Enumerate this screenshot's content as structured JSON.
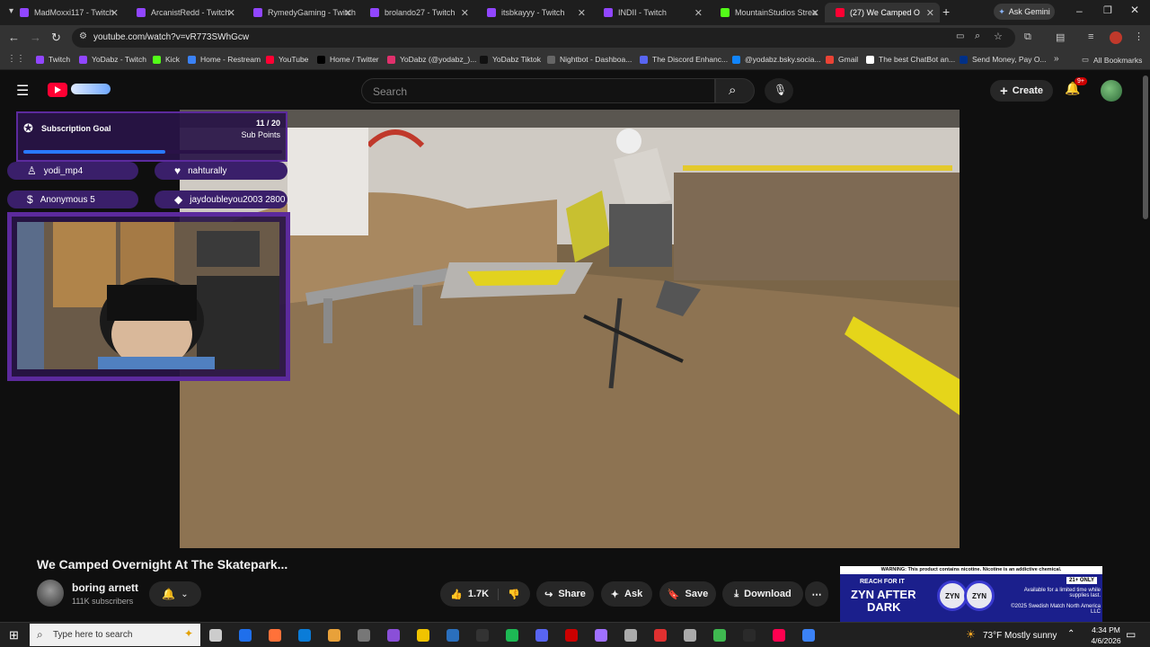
{
  "tabs": [
    {
      "label": "MadMoxxi117 - Twitch",
      "color": "#9146ff"
    },
    {
      "label": "ArcanistRedd - Twitch",
      "color": "#9146ff"
    },
    {
      "label": "RymedyGaming - Twitch",
      "color": "#9146ff"
    },
    {
      "label": "brolando27 - Twitch",
      "color": "#9146ff"
    },
    {
      "label": "itsbkayyy - Twitch",
      "color": "#9146ff"
    },
    {
      "label": "INDII - Twitch",
      "color": "#9146ff"
    },
    {
      "label": "MountainStudios Strea",
      "color": "#53fc18"
    },
    {
      "label": "(27) We Camped O",
      "color": "#ff0033"
    }
  ],
  "ask_gemini": "Ask Gemini",
  "url": "youtube.com/watch?v=vR773SWhGcw",
  "bookmarks": [
    {
      "label": "Twitch",
      "color": "#9146ff"
    },
    {
      "label": "YoDabz - Twitch",
      "color": "#9146ff"
    },
    {
      "label": "Kick",
      "color": "#53fc18"
    },
    {
      "label": "Home - Restream",
      "color": "#3b82f6"
    },
    {
      "label": "YouTube",
      "color": "#ff0033"
    },
    {
      "label": "Home / Twitter",
      "color": "#000000"
    },
    {
      "label": "YoDabz (@yodabz_)...",
      "color": "#e1306c"
    },
    {
      "label": "YoDabz Tiktok",
      "color": "#111111"
    },
    {
      "label": "Nightbot - Dashboa...",
      "color": "#666666"
    },
    {
      "label": "The Discord Enhanc...",
      "color": "#5865f2"
    },
    {
      "label": "@yodabz.bsky.socia...",
      "color": "#1185fe"
    },
    {
      "label": "Gmail",
      "color": "#ea4335"
    },
    {
      "label": "The best ChatBot an...",
      "color": "#ffffff"
    },
    {
      "label": "Send Money, Pay O...",
      "color": "#003087"
    }
  ],
  "all_bookmarks": "All Bookmarks",
  "youtube": {
    "search_placeholder": "Search",
    "create_label": "Create",
    "notif_badge": "9+"
  },
  "overlay": {
    "goal_title": "Subscription Goal",
    "goal_count": "11 / 20",
    "goal_unit": "Sub Points",
    "goal_progress": 0.55,
    "recent": [
      {
        "name": "yodi_mp4",
        "icon": "user-icon"
      },
      {
        "name": "nahturally",
        "icon": "heart-icon"
      },
      {
        "name": "Anonymous 5",
        "icon": "dollar-icon"
      },
      {
        "name": "jaydoubleyou2003 2800",
        "icon": "diamond-icon"
      }
    ]
  },
  "video": {
    "title": "We Camped Overnight At The Skatepark...",
    "channel": "boring arnett",
    "subscribers": "111K subscribers",
    "likes": "1.7K",
    "share": "Share",
    "ask": "Ask",
    "save": "Save",
    "download": "Download"
  },
  "ad": {
    "warning": "WARNING: This product contains nicotine. Nicotine is an addictive chemical.",
    "line1": "REACH FOR IT",
    "line2": "ZYN AFTER",
    "line3": "DARK",
    "age": "21+ ONLY",
    "fine": "Available for a limited time while supplies last.",
    "copyright": "©2025 Swedish Match North America LLC",
    "brand": "ZYN"
  },
  "taskbar": {
    "search_placeholder": "Type here to search",
    "weather": "73°F  Mostly sunny",
    "time": "4:34 PM",
    "date": "4/6/2026"
  }
}
